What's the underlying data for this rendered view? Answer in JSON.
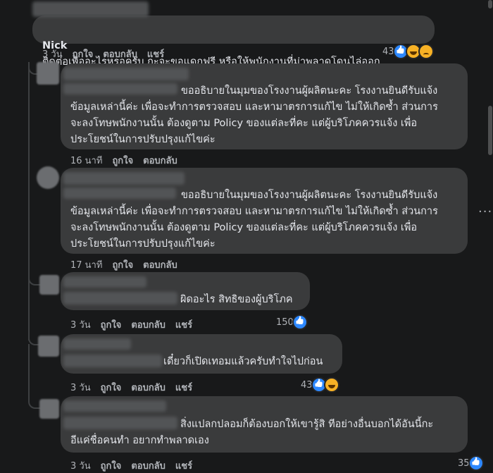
{
  "comments": [
    {
      "name": "Nick",
      "text": "ติดต่อเพื่ออะไรหรอครับ กะจะขอแดกฟรี หรือให้พนักงานที่ม่าพลาดโดนไล่ออก",
      "time": "3 วัน",
      "like": "ถูกใจ",
      "reply": "ตอบกลับ",
      "share": "แชร์",
      "reaction_count": "43",
      "reactions": [
        "like-icon",
        "haha-icon",
        "sad-icon"
      ]
    },
    {
      "text": "ขออธิบายในมุมของโรงงานผู้ผลิตนะคะ โรงงานยินดีรับแจ้ง\nข้อมูลเหล่านี้ค่ะ เพื่อจะทำการตรวจสอบ และหามาตรการแก้ไข ไม่ให้เกิดซ้ำ ส่วนการ\nจะลงโทษพนักงานนั้น ต้องดูตาม Policy ของแต่ละที่คะ แต่ผู้บริโภคควรแจ้ง เพื่อ\nประโยชน์ในการปรับปรุงแก้ไขค่ะ",
      "time": "16 นาที",
      "like": "ถูกใจ",
      "reply": "ตอบกลับ"
    },
    {
      "text": "ขออธิบายในมุมของโรงงานผู้ผลิตนะคะ โรงงานยินดีรับแจ้ง\nข้อมูลเหล่านี้ค่ะ เพื่อจะทำการตรวจสอบ และหามาตรการแก้ไข ไม่ให้เกิดซ้ำ ส่วนการ\nจะลงโทษพนักงานนั้น ต้องดูตาม Policy ของแต่ละที่คะ แต่ผู้บริโภคควรแจ้ง เพื่อ\nประโยชน์ในการปรับปรุงแก้ไขค่ะ",
      "time": "17 นาที",
      "like": "ถูกใจ",
      "reply": "ตอบกลับ",
      "more": "···"
    },
    {
      "text": "ผิดอะไร สิทธิของผู้บริโภค",
      "time": "3 วัน",
      "like": "ถูกใจ",
      "reply": "ตอบกลับ",
      "share": "แชร์",
      "reaction_count": "150",
      "reactions": [
        "like-icon"
      ]
    },
    {
      "text": "เดี๋ยวก็เปิดเทอมแล้วครับทำใจไปก่อน",
      "time": "3 วัน",
      "like": "ถูกใจ",
      "reply": "ตอบกลับ",
      "share": "แชร์",
      "reaction_count": "43",
      "reactions": [
        "like-icon",
        "haha-icon"
      ]
    },
    {
      "text": "สิ่งแปลกปลอมก็ต้องบอกให้เขารู้สิ ทีอย่างอื่นบอกได้อันนี้กะ\nอีแค่ชื่อคนทำ อยากทำพลาดเอง",
      "time": "3 วัน",
      "like": "ถูกใจ",
      "reply": "ตอบกลับ",
      "share": "แชร์",
      "reaction_count": "35",
      "reactions": [
        "like-icon"
      ]
    }
  ],
  "colors": {
    "background": "#18191a",
    "bubble": "#3a3b3c",
    "text": "#e4e6eb",
    "secondary": "#b0b3b8",
    "like_blue": "#2d88ff",
    "emoji_yellow": "#f7b125"
  }
}
